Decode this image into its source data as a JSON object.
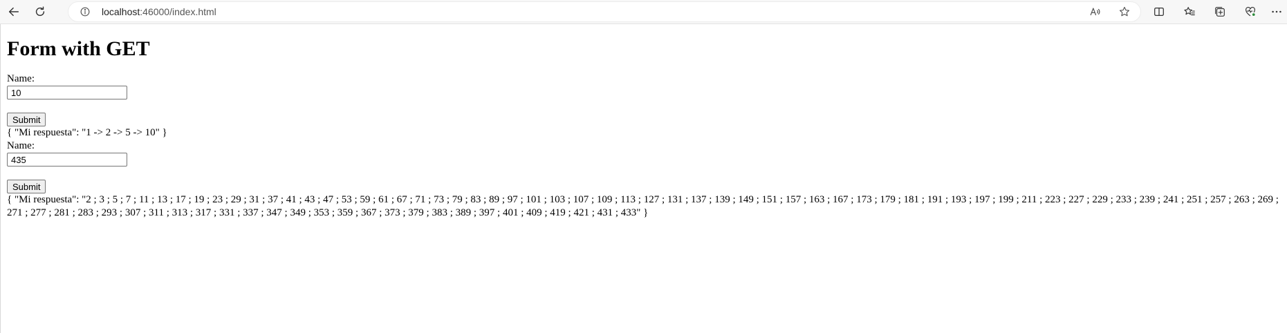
{
  "browser": {
    "url_host": "localhost",
    "url_path": ":46000/index.html"
  },
  "page": {
    "title": "Form with GET",
    "forms": [
      {
        "label": "Name:",
        "value": "10",
        "submit_label": "Submit",
        "response": "{ \"Mi respuesta\": \"1 -> 2 -> 5 -> 10\" }"
      },
      {
        "label": "Name:",
        "value": "435",
        "submit_label": "Submit",
        "response": "{ \"Mi respuesta\": \"2 ; 3 ; 5 ; 7 ; 11 ; 13 ; 17 ; 19 ; 23 ; 29 ; 31 ; 37 ; 41 ; 43 ; 47 ; 53 ; 59 ; 61 ; 67 ; 71 ; 73 ; 79 ; 83 ; 89 ; 97 ; 101 ; 103 ; 107 ; 109 ; 113 ; 127 ; 131 ; 137 ; 139 ; 149 ; 151 ; 157 ; 163 ; 167 ; 173 ; 179 ; 181 ; 191 ; 193 ; 197 ; 199 ; 211 ; 223 ; 227 ; 229 ; 233 ; 239 ; 241 ; 251 ; 257 ; 263 ; 269 ; 271 ; 277 ; 281 ; 283 ; 293 ; 307 ; 311 ; 313 ; 317 ; 331 ; 337 ; 347 ; 349 ; 353 ; 359 ; 367 ; 373 ; 379 ; 383 ; 389 ; 397 ; 401 ; 409 ; 419 ; 421 ; 431 ; 433\" }"
      }
    ]
  },
  "icons": {
    "back": "back-arrow-icon",
    "refresh": "refresh-icon",
    "info": "info-icon",
    "read_aloud": "read-aloud-icon",
    "favorite": "star-icon",
    "split_screen": "split-screen-icon",
    "favorites": "favorites-icon",
    "collections": "collections-icon",
    "browser_essentials": "heart-pulse-icon",
    "more": "more-icon"
  }
}
